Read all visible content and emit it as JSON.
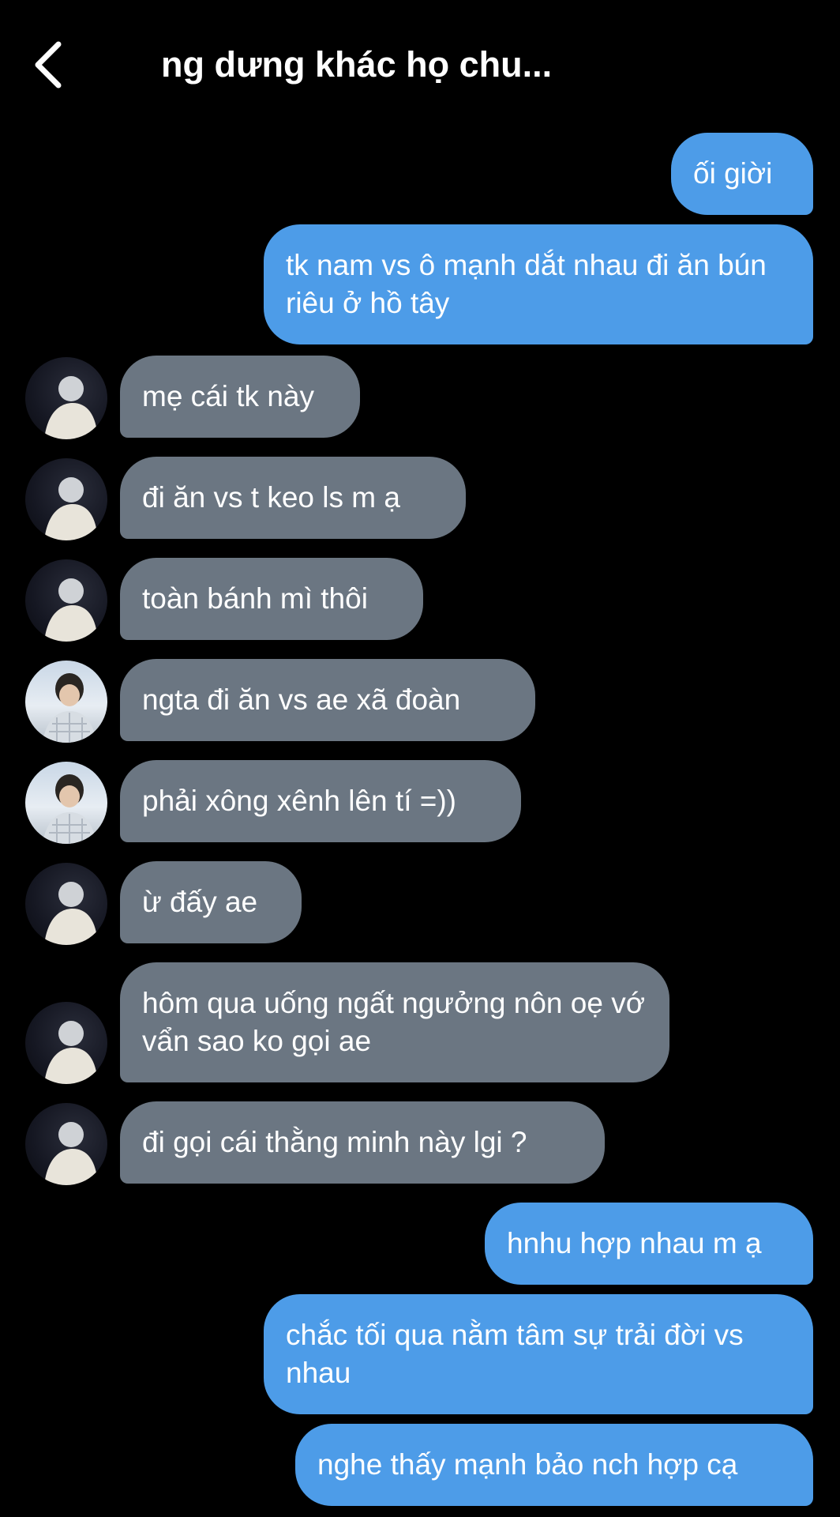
{
  "header": {
    "title": "ng dưng khác họ chu..."
  },
  "messages": [
    {
      "side": "out",
      "text": "ối giời"
    },
    {
      "side": "out",
      "text": "tk nam vs ô mạnh dắt nhau đi ăn bún riêu ở hồ tây"
    },
    {
      "side": "in",
      "avatar": "avatar-1",
      "text": "mẹ cái tk này"
    },
    {
      "side": "in",
      "avatar": "avatar-1",
      "text": "đi ăn vs t keo ls m ạ"
    },
    {
      "side": "in",
      "avatar": "avatar-1",
      "text": "toàn bánh mì thôi"
    },
    {
      "side": "in",
      "avatar": "avatar-2",
      "text": "ngta đi ăn vs ae xã đoàn"
    },
    {
      "side": "in",
      "avatar": "avatar-2",
      "text": "phải xông xênh lên tí =))"
    },
    {
      "side": "in",
      "avatar": "avatar-1",
      "text": "ừ đấy ae"
    },
    {
      "side": "in",
      "avatar": "avatar-1",
      "text": "hôm qua uống ngất ngưởng nôn oẹ vớ vẩn sao ko gọi ae"
    },
    {
      "side": "in",
      "avatar": "avatar-1",
      "text": "đi gọi cái thằng minh này lgi ?"
    },
    {
      "side": "out",
      "text": "hnhu hợp nhau m ạ"
    },
    {
      "side": "out",
      "text": "chắc tối qua nằm tâm sự trải đời vs nhau"
    },
    {
      "side": "out",
      "text": "nghe thấy mạnh bảo nch hợp cạ"
    }
  ],
  "colors": {
    "background": "#000000",
    "outgoing_bubble": "#4d9ce8",
    "incoming_bubble": "#6b7682",
    "text": "#ffffff"
  },
  "icons": {
    "back": "chevron-left-icon"
  }
}
